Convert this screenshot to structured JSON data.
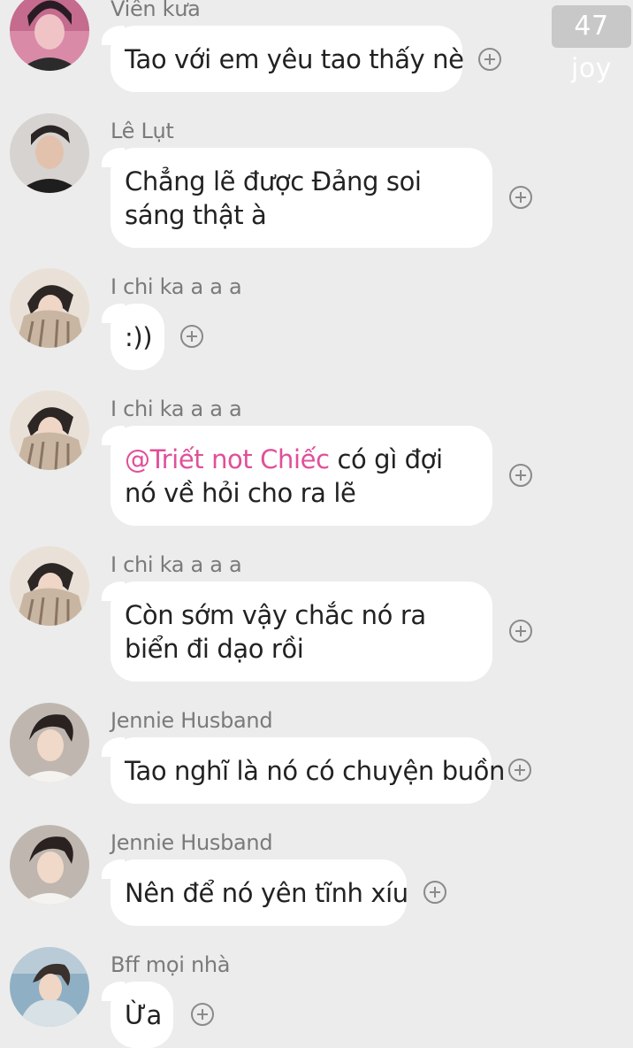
{
  "badge": {
    "text": "47 joy"
  },
  "messages": [
    {
      "sender": "Viên kưa",
      "text": "Tao với em yêu tao thấy nè"
    },
    {
      "sender": "Lê Lụt",
      "text": "Chẳng lẽ được Đảng soi sáng thật à"
    },
    {
      "sender": "I chi ka a a a",
      "text": ":))"
    },
    {
      "sender": "I chi ka a a a",
      "mention": "@Triết not Chiếc",
      "text": " có gì đợi nó về hỏi cho ra lẽ"
    },
    {
      "sender": "I chi ka a a a",
      "text": "Còn sớm vậy chắc nó ra biển đi dạo rồi"
    },
    {
      "sender": "Jennie Husband",
      "text": "Tao nghĩ là nó có chuyện buồn"
    },
    {
      "sender": "Jennie Husband",
      "text": "Nên để nó yên tĩnh xíu"
    },
    {
      "sender": "Bff mọi nhà",
      "text": "Ừa"
    }
  ],
  "icons": {
    "add_reaction": "plus-circle-icon",
    "avatar": "user-avatar"
  },
  "colors": {
    "background": "#ececec",
    "bubble": "#ffffff",
    "mention": "#e0509a",
    "sender": "#7a7a7a",
    "badge": "#c8c8c8"
  }
}
